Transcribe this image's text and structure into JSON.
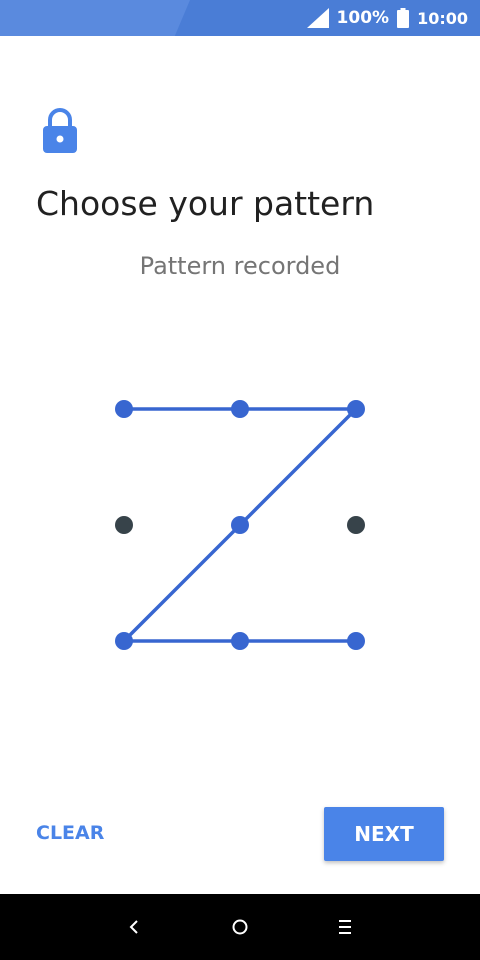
{
  "status_bar": {
    "battery": "100%",
    "time": "10:00",
    "icons": [
      "signal-icon",
      "battery-icon"
    ]
  },
  "header": {
    "icon": "lock-icon",
    "title": "Choose your pattern",
    "subtitle": "Pattern recorded"
  },
  "pattern": {
    "grid_rows": 3,
    "grid_cols": 3,
    "selected_sequence": [
      0,
      1,
      2,
      4,
      6,
      7,
      8
    ],
    "active_color": "#3866d0",
    "inactive_color": "#37434a"
  },
  "footer": {
    "clear_label": "CLEAR",
    "next_label": "NEXT"
  },
  "nav_bar": {
    "icons": [
      "back-icon",
      "home-icon",
      "recents-icon"
    ]
  },
  "colors": {
    "accent": "#4a84e8",
    "status_bar": "#4a7dd6"
  }
}
